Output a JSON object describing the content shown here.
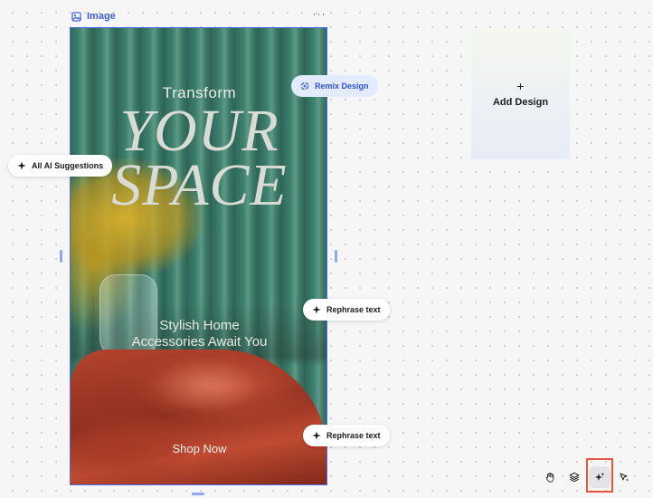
{
  "frame": {
    "label": "Image",
    "more_label": "···"
  },
  "design": {
    "heading_small": "Transform",
    "heading_big_line1": "YOUR",
    "heading_big_line2": "SPACE",
    "subheading_line1": "Stylish Home",
    "subheading_line2": "Accessories Await You",
    "cta": "Shop Now"
  },
  "ai_pills": {
    "remix": "Remix Design",
    "all_suggestions": "All AI Suggestions",
    "rephrase_1": "Rephrase text",
    "rephrase_2": "Rephrase text"
  },
  "add_design": {
    "plus": "+",
    "label": "Add Design"
  },
  "toolbar": {
    "icons": [
      "hand-icon",
      "layers-icon",
      "ai-sparkle-icon",
      "cursor-sparkle-icon"
    ]
  },
  "colors": {
    "selection_blue": "#4a6cf7",
    "highlight_red": "#e8553f",
    "remix_bg": "#e2ebff"
  }
}
